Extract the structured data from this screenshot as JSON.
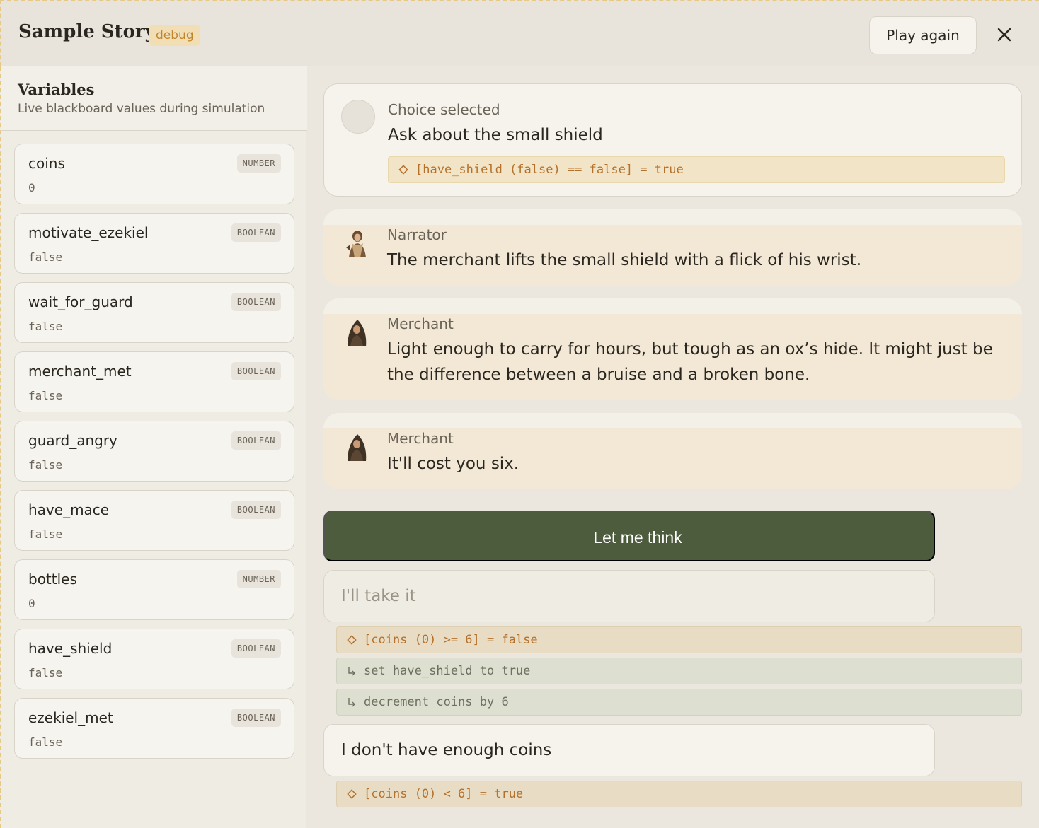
{
  "header": {
    "title": "Sample Story",
    "badge": "debug",
    "play_again": "Play again",
    "close_icon": "close-icon"
  },
  "sidebar": {
    "title": "Variables",
    "subtitle": "Live blackboard values during simulation",
    "variables": [
      {
        "name": "coins",
        "type": "NUMBER",
        "value": "0"
      },
      {
        "name": "motivate_ezekiel",
        "type": "BOOLEAN",
        "value": "false"
      },
      {
        "name": "wait_for_guard",
        "type": "BOOLEAN",
        "value": "false"
      },
      {
        "name": "merchant_met",
        "type": "BOOLEAN",
        "value": "false"
      },
      {
        "name": "guard_angry",
        "type": "BOOLEAN",
        "value": "false"
      },
      {
        "name": "have_mace",
        "type": "BOOLEAN",
        "value": "false"
      },
      {
        "name": "bottles",
        "type": "NUMBER",
        "value": "0"
      },
      {
        "name": "have_shield",
        "type": "BOOLEAN",
        "value": "false"
      },
      {
        "name": "ezekiel_met",
        "type": "BOOLEAN",
        "value": "false"
      }
    ]
  },
  "transcript": {
    "choice_label": "Choice selected",
    "choice_text": "Ask about the small shield",
    "choice_condition": "[have_shield (false) == false] = true",
    "lines": [
      {
        "speaker": "Narrator",
        "text": "The merchant lifts the small shield with a flick of his wrist."
      },
      {
        "speaker": "Merchant",
        "text": "Light enough to carry for hours, but tough as an ox’s hide. It might just be the difference between a bruise and a broken bone."
      },
      {
        "speaker": "Merchant",
        "text": "It'll cost you six."
      }
    ]
  },
  "options": {
    "selected": "Let me think",
    "take_it": "I'll take it",
    "take_it_condition": "[coins (0) >= 6] = false",
    "take_it_effects": [
      "set have_shield to true",
      "decrement coins by 6"
    ],
    "no_coins": "I don't have enough coins",
    "no_coins_condition": "[coins (0) < 6] = true"
  },
  "colors": {
    "accent_green": "#4d5c3d",
    "amber": "#b5702b",
    "dialog_bg": "#f3e8d5"
  }
}
